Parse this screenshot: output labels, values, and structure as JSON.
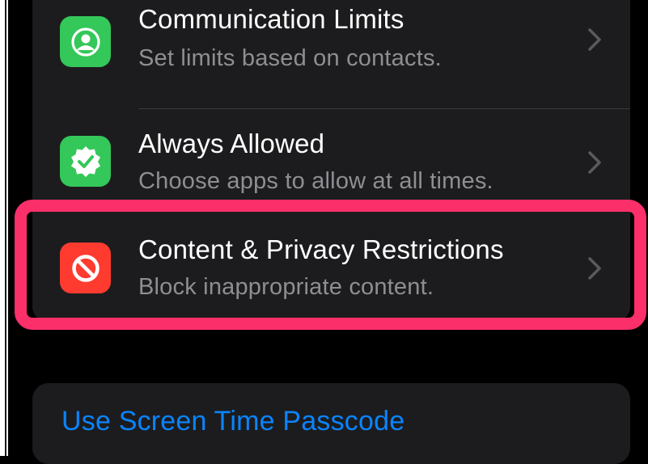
{
  "colors": {
    "background": "#000000",
    "card": "#1c1c1e",
    "highlight": "#fb2f6a",
    "link": "#0a84ff",
    "green_icon": "#34c759",
    "red_icon": "#ff3b30"
  },
  "settings_rows": [
    {
      "title": "Communication Limits",
      "subtitle": "Set limits based on contacts.",
      "icon": "person-circle-icon"
    },
    {
      "title": "Always Allowed",
      "subtitle": "Choose apps to allow at all times.",
      "icon": "checkmark-seal-icon"
    },
    {
      "title": "Content & Privacy Restrictions",
      "subtitle": "Block inappropriate content.",
      "icon": "prohibited-icon"
    }
  ],
  "passcode": {
    "label": "Use Screen Time Passcode"
  }
}
